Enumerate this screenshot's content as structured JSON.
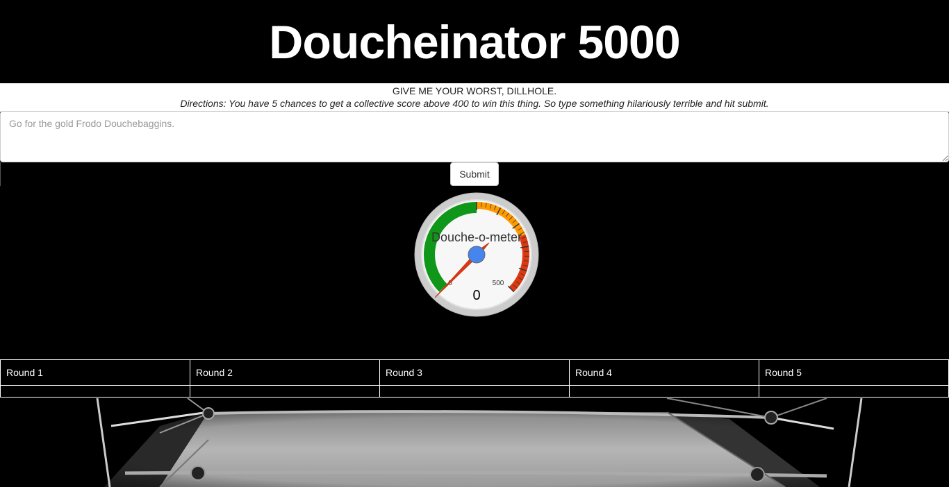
{
  "header": {
    "title": "Doucheinator 5000"
  },
  "intro": {
    "tagline": "GIVE ME YOUR WORST, DILLHOLE.",
    "directions": "Directions: You have 5 chances to get a collective score above 400 to win this thing. So type something hilariously terrible and hit submit."
  },
  "input": {
    "placeholder": "Go for the gold Frodo Douchebaggins.",
    "value": ""
  },
  "submit": {
    "label": "Submit"
  },
  "gauge": {
    "title": "Douche-o-meter",
    "value": "0",
    "min_label": "0",
    "max_label": "500",
    "colors": {
      "green": "#109618",
      "orange": "#FF9900",
      "red": "#DC3912",
      "needle": "#dc3912",
      "hub": "#4684ee"
    }
  },
  "rounds": {
    "headers": [
      "Round 1",
      "Round 2",
      "Round 3",
      "Round 4",
      "Round 5"
    ],
    "scores": [
      "",
      "",
      "",
      "",
      ""
    ]
  },
  "background": {
    "image": "boxing-ring-photo"
  }
}
